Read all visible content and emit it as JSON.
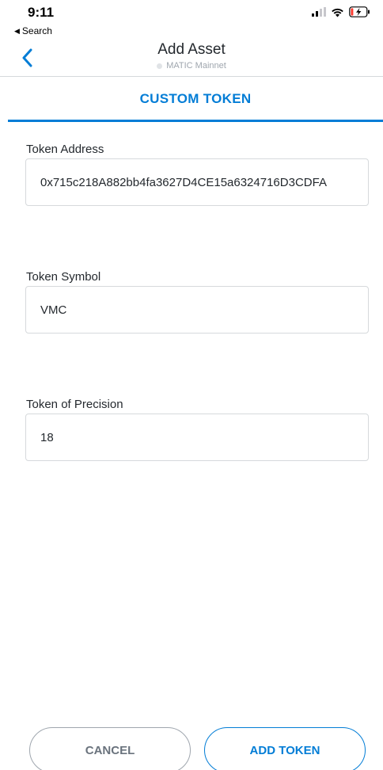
{
  "status_bar": {
    "time": "9:11",
    "back_label": "Search",
    "back_glyph": "◀"
  },
  "nav": {
    "title": "Add Asset",
    "network": "MATIC Mainnet"
  },
  "tabs": [
    {
      "label": "CUSTOM TOKEN",
      "active": true
    }
  ],
  "form": {
    "address": {
      "label": "Token Address",
      "value": "0x715c218A882bb4fa3627D4CE15a6324716D3CDFA"
    },
    "symbol": {
      "label": "Token Symbol",
      "value": "VMC"
    },
    "precision": {
      "label": "Token of Precision",
      "value": "18"
    }
  },
  "buttons": {
    "cancel": "CANCEL",
    "add": "ADD TOKEN"
  },
  "colors": {
    "accent": "#037dd6",
    "border": "#d6d9dc",
    "muted": "#9fa6ae"
  }
}
